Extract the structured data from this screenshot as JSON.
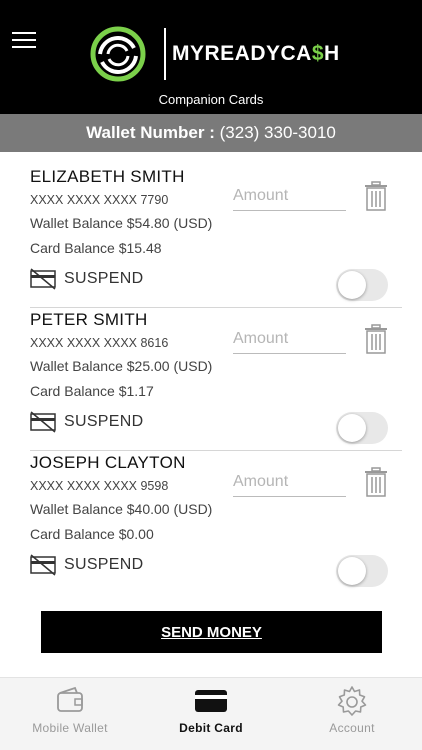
{
  "header": {
    "brand": {
      "prefix": "MYREADYCA",
      "dollar": "$",
      "suffix": "H"
    },
    "subtitle": "Companion Cards"
  },
  "wallet": {
    "label": "Wallet Number :",
    "number": "(323) 330-3010"
  },
  "cards": [
    {
      "name": "ELIZABETH SMITH",
      "number": "XXXX XXXX XXXX 7790",
      "wallet_balance": "Wallet Balance $54.80 (USD)",
      "card_balance": "Card Balance $15.48",
      "amount_placeholder": "Amount",
      "suspend_label": "SUSPEND",
      "suspended": false
    },
    {
      "name": "PETER SMITH",
      "number": "XXXX XXXX XXXX 8616",
      "wallet_balance": "Wallet Balance $25.00 (USD)",
      "card_balance": "Card Balance $1.17",
      "amount_placeholder": "Amount",
      "suspend_label": "SUSPEND",
      "suspended": false
    },
    {
      "name": "JOSEPH CLAYTON",
      "number": "XXXX XXXX XXXX 9598",
      "wallet_balance": "Wallet Balance $40.00 (USD)",
      "card_balance": "Card Balance $0.00",
      "amount_placeholder": "Amount",
      "suspend_label": "SUSPEND",
      "suspended": false
    }
  ],
  "actions": {
    "send_money": "SEND MONEY"
  },
  "tabbar": {
    "tabs": [
      {
        "label": "Mobile Wallet",
        "icon": "wallet-icon",
        "active": false
      },
      {
        "label": "Debit Card",
        "icon": "debit-card-icon",
        "active": true
      },
      {
        "label": "Account",
        "icon": "gear-icon",
        "active": false
      }
    ]
  },
  "colors": {
    "header_bg": "#000000",
    "brand_accent": "#7bd04a",
    "wallet_bar_bg": "#7a7a7a",
    "button_bg": "#000000",
    "tabbar_bg": "#f4f4f4"
  }
}
